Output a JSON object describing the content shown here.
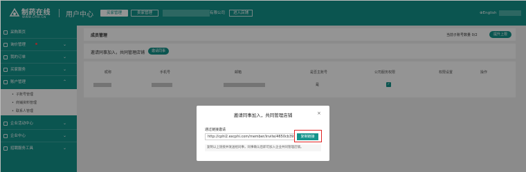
{
  "header": {
    "logo_text": "制药在线",
    "logo_sub": "WWW.CPHI.CN",
    "title": "用户中心",
    "tabs": [
      {
        "label": "买家管理",
        "active": true
      },
      {
        "label": "卖家管理",
        "active": false
      }
    ],
    "company_suffix": "有限公司",
    "enter_shop_label": "进入店铺",
    "language": "English"
  },
  "sidebar": {
    "items": [
      {
        "label": "采购首页",
        "icon": "home-icon"
      },
      {
        "label": "询价管理",
        "icon": "inquiry-icon",
        "hot": true
      },
      {
        "label": "我的订单",
        "icon": "order-icon"
      },
      {
        "label": "买家服务",
        "icon": "service-icon"
      },
      {
        "label": "账户管理",
        "icon": "user-icon",
        "expanded": true
      },
      {
        "label": "企业活动中心",
        "icon": "activity-icon"
      },
      {
        "label": "企业中心",
        "icon": "company-icon"
      },
      {
        "label": "招聘服务工具",
        "icon": "tool-icon"
      }
    ],
    "account_sub_items": [
      "子账号管理",
      "商铺资料管理",
      "联系人管理"
    ]
  },
  "main": {
    "section_title": "成员管理",
    "quota_text": "当前子账号数量 0/2",
    "open_button": "提升上限",
    "invite_text": "邀请同事加入，共同管理店铺",
    "invite_button": "邀请同事",
    "table": {
      "headers": [
        "昵称",
        "手机号",
        "邮箱",
        "是否主账号",
        "公司服务权限",
        "权限设置",
        "操作"
      ],
      "rows": [
        {
          "is_main": "是",
          "service_permission": true
        }
      ]
    }
  },
  "modal": {
    "title": "邀请同事加入，共同管理店铺",
    "close_icon": "×",
    "link_label": "通过链接邀请",
    "link_value": "http://cphi2.excphi.com/member/invite/4650cb3915042",
    "copy_button": "复制链接",
    "hint": "复制以上链接并发送给同事，同事确认后即可加入企业共同管理店铺。"
  },
  "colors": {
    "brand": "#13938b",
    "highlight": "#e02020"
  }
}
